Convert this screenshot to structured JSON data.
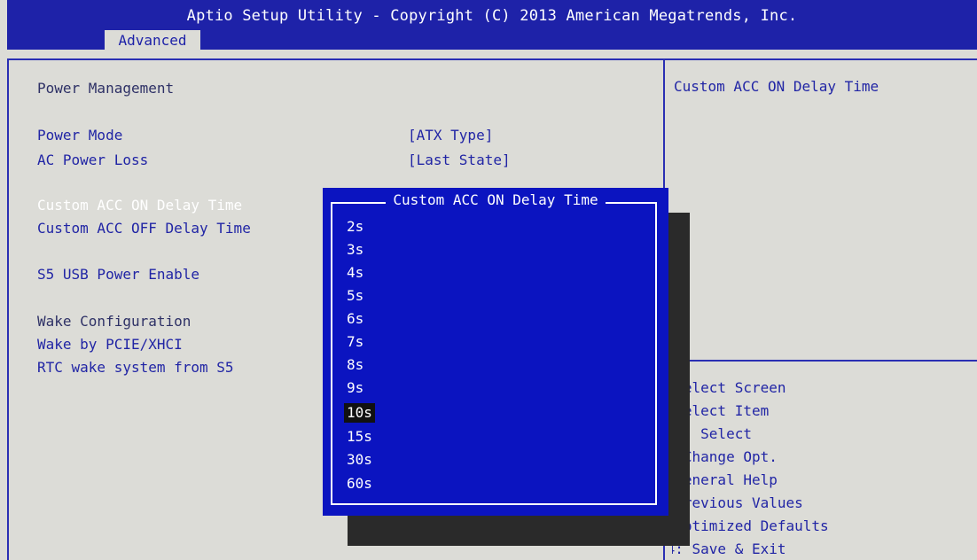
{
  "header": {
    "title": "Aptio Setup Utility - Copyright (C) 2013 American Megatrends, Inc.",
    "active_tab": "Advanced"
  },
  "main": {
    "section_title": "Power Management",
    "items": [
      {
        "label": "Power Mode",
        "value": "[ATX Type]"
      },
      {
        "label": "AC Power Loss",
        "value": "[Last State]"
      },
      {
        "label": "Custom ACC ON Delay Time"
      },
      {
        "label": "Custom ACC OFF Delay Time"
      },
      {
        "label": "S5 USB Power Enable"
      }
    ],
    "wake_title": "Wake Configuration",
    "wake_items": [
      {
        "label": "Wake by PCIE/XHCI"
      },
      {
        "label": "RTC wake system from S5"
      }
    ]
  },
  "help": {
    "text": "Custom ACC ON Delay Time"
  },
  "keys": [
    ": Select Screen",
    ": Select Item",
    "ter: Select",
    "-: Change Opt.",
    ": General Help",
    ": Previous Values",
    ": Optimized Defaults",
    "F4: Save & Exit"
  ],
  "popup": {
    "title": "Custom ACC ON Delay Time",
    "options": [
      "2s",
      "3s",
      "4s",
      "5s",
      "6s",
      "7s",
      "8s",
      "9s",
      "10s",
      "15s",
      "30s",
      "60s"
    ],
    "selected": "10s"
  }
}
